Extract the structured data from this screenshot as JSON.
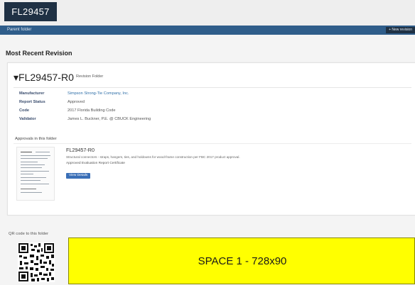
{
  "header": {
    "logo_text": "FL29457",
    "nav_link": "Parent folder",
    "nav_button": "+ New revision"
  },
  "main": {
    "section_title": "Most Recent Revision",
    "revision": {
      "title": "FL29457-R0",
      "badge": "Revision Folder",
      "properties": [
        {
          "label": "Manufacturer",
          "value": "Simpson Strong-Tie Company, Inc."
        },
        {
          "label": "Report Status",
          "value": "Approved"
        },
        {
          "label": "Code",
          "value": "2017 Florida Building Code"
        },
        {
          "label": "Validator",
          "value": "James L. Buckner, P.E. @ CBUCK Engineering"
        }
      ],
      "approvals_title": "Approvals in this folder",
      "document": {
        "name": "FL29457-R0",
        "description": "Structural connectors - straps, hangers, ties, and holdowns for wood-frame construction per FBC 2017 product approval.",
        "meta": "Approved   Evaluation Report   Certificate",
        "button": "View Details"
      }
    },
    "qr_label": "QR code to this folder",
    "ad_text": "SPACE 1 - 728x90"
  },
  "colors": {
    "nav_blue": "#2f5d8a",
    "logo_bg": "#1f3144",
    "ad_yellow": "#ffff00",
    "link_blue": "#2f6fa8"
  }
}
